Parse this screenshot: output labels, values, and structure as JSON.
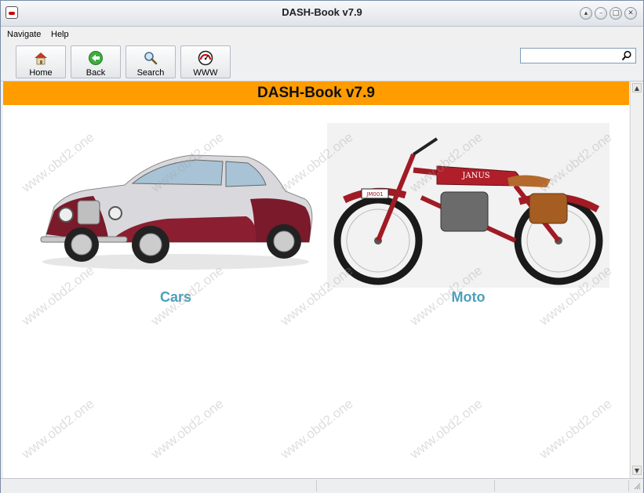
{
  "window": {
    "title": "DASH-Book v7.9"
  },
  "menu": {
    "items": [
      "Navigate",
      "Help"
    ]
  },
  "toolbar": {
    "home_label": "Home",
    "back_label": "Back",
    "search_label": "Search",
    "www_label": "WWW"
  },
  "search": {
    "placeholder": ""
  },
  "header": {
    "title": "DASH-Book v7.9",
    "color": "#ff9c00"
  },
  "categories": [
    {
      "label": "Cars"
    },
    {
      "label": "Moto"
    }
  ],
  "watermark": "www.obd2.one",
  "colors": {
    "link": "#4aa0bb",
    "accent": "#ff9c00"
  }
}
